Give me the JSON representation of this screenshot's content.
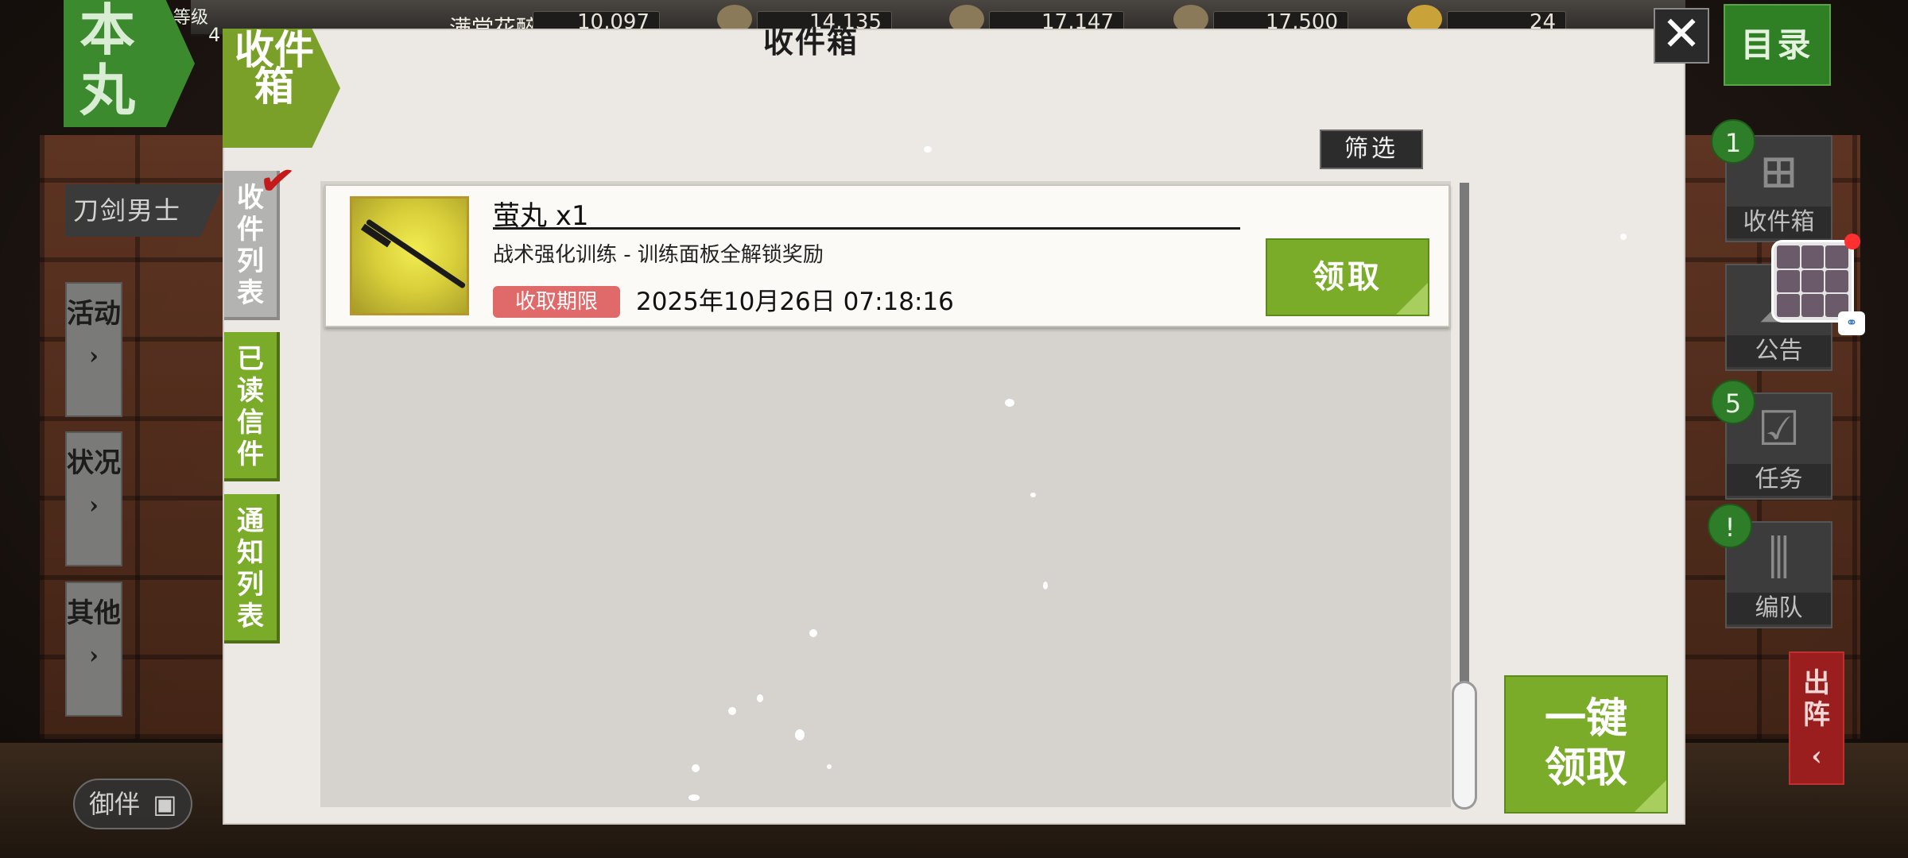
{
  "header": {
    "emblem": "本丸",
    "level_label": "等级",
    "level_value": "4",
    "player_name": "满堂花醉客",
    "resources": [
      "10,097",
      "14,135",
      "17,147",
      "17,500",
      "24"
    ]
  },
  "left_sidebar": {
    "section_title": "刀剑男士",
    "buttons": [
      {
        "label": "活动"
      },
      {
        "label": "状况"
      },
      {
        "label": "其他"
      }
    ],
    "camera_label": "御伴"
  },
  "right_sidebar": {
    "menu_label": "目录",
    "buttons": [
      {
        "label": "收件箱",
        "badge": "1"
      },
      {
        "label": "公告",
        "badge": ""
      },
      {
        "label": "任务",
        "badge": "5"
      },
      {
        "label": "编队",
        "badge": "!"
      }
    ],
    "sortie_label": "出阵"
  },
  "dialog": {
    "title": "收件箱",
    "tag": "收件箱",
    "close_symbol": "✕",
    "tabs": [
      {
        "label": "收件列表",
        "active": true
      },
      {
        "label": "已读信件",
        "active": false
      },
      {
        "label": "通知列表",
        "active": false
      }
    ],
    "filter_label": "筛选",
    "claim_all_label_line1": "一键",
    "claim_all_label_line2": "领取",
    "items": [
      {
        "name": "萤丸 x1",
        "description": "战术强化训练 - 训练面板全解锁奖励",
        "deadline_label": "收取期限",
        "deadline": "2025年10月26日 07:18:16",
        "claim_label": "领取"
      }
    ]
  },
  "colors": {
    "accent_green": "#7aac2a",
    "deadline_red": "#e06a6a",
    "dialog_bg": "#ece9e4"
  }
}
